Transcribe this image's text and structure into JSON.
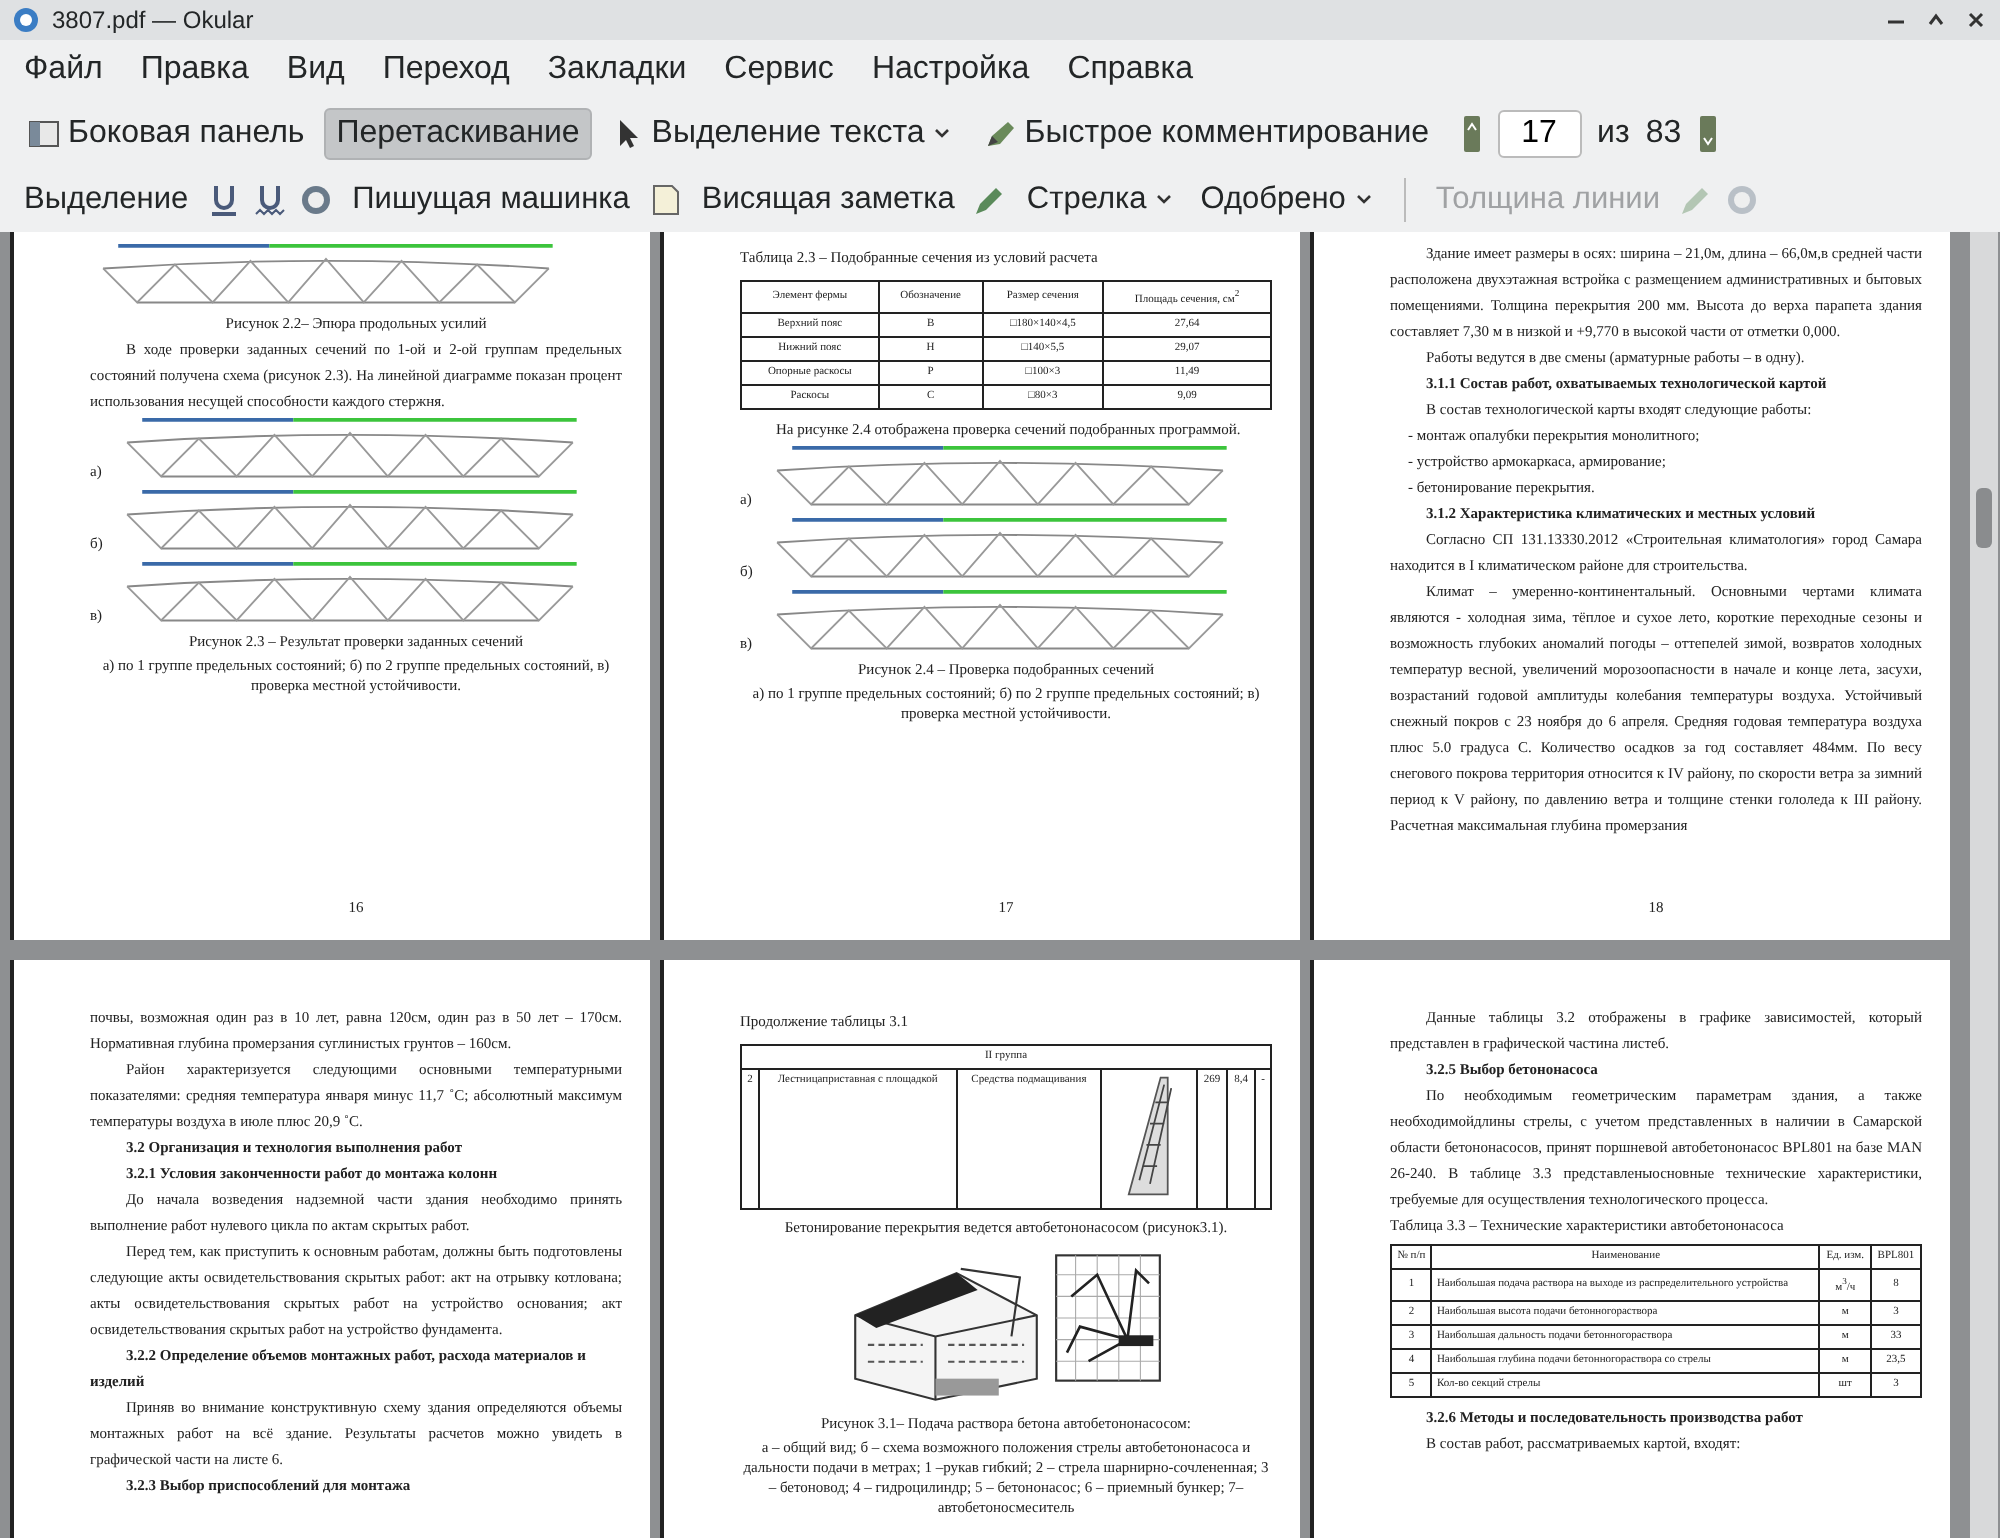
{
  "window": {
    "title": "3807.pdf — Okular"
  },
  "menu": [
    "Файл",
    "Правка",
    "Вид",
    "Переход",
    "Закладки",
    "Сервис",
    "Настройка",
    "Справка"
  ],
  "toolbar": [
    {
      "kind": "button",
      "label": "Боковая панель",
      "selected": false
    },
    {
      "kind": "button",
      "label": "Перетаскивание",
      "selected": true
    },
    {
      "kind": "dropdown",
      "label": "Выделение текста",
      "selected": false
    },
    {
      "kind": "button",
      "label": "Быстрое комментирование",
      "selected": false
    },
    {
      "kind": "pager",
      "value": "17",
      "of": "из",
      "total": "83"
    }
  ],
  "annotation_bar": [
    {
      "kind": "text",
      "label": "Выделение",
      "disabled": false
    },
    {
      "kind": "icon",
      "disabled": false
    },
    {
      "kind": "icon",
      "disabled": false
    },
    {
      "kind": "icon",
      "disabled": false
    },
    {
      "kind": "text",
      "label": "Пишущая машинка",
      "disabled": false
    },
    {
      "kind": "icon",
      "disabled": false
    },
    {
      "kind": "text",
      "label": "Висящая заметка",
      "disabled": false
    },
    {
      "kind": "icon",
      "disabled": false
    },
    {
      "kind": "dropdown",
      "label": "Стрелка",
      "disabled": false
    },
    {
      "kind": "dropdown",
      "label": "Одобрено",
      "disabled": false
    },
    {
      "kind": "separator"
    },
    {
      "kind": "text",
      "label": "Толщина линии",
      "disabled": true
    },
    {
      "kind": "icon",
      "disabled": true
    },
    {
      "kind": "icon",
      "disabled": true
    }
  ],
  "pages": [
    {
      "blocks": [
        {
          "kind": "truss"
        },
        {
          "kind": "caption",
          "text": "Рисунок 2.2– Эпюра продольных усилий"
        },
        {
          "kind": "para",
          "text": "В ходе проверки заданных сечений по 1-ой и 2-ой группам предельных состояний получена схема (рисунок 2.3). На линейной диаграмме показан процент использования несущей способности каждого стержня."
        },
        {
          "kind": "truss",
          "label": "а)"
        },
        {
          "kind": "truss",
          "label": "б)"
        },
        {
          "kind": "truss",
          "label": "в)"
        },
        {
          "kind": "caption",
          "text": "Рисунок 2.3 – Результат проверки заданных сечений"
        },
        {
          "kind": "caption",
          "text": "а) по 1 группе предельных состояний; б) по 2 группе предельных состояний, в) проверка местной устойчивости."
        },
        {
          "kind": "page_number",
          "text": "16"
        }
      ]
    },
    {
      "blocks": [
        {
          "kind": "label",
          "text": "Таблица 2.3 – Подобранные сечения из условий расчета"
        },
        {
          "kind": "table",
          "columns": [
            "Элемент фермы",
            "Обозначение",
            "Размер сечения",
            "Площадь сечения, см$^{2}$"
          ],
          "rows": [
            [
              "Верхний пояс",
              "В",
              "□180×140×4,5",
              "27,64"
            ],
            [
              "Нижний пояс",
              "Н",
              "□140×5,5",
              "29,07"
            ],
            [
              "Опорные раскосы",
              "Р",
              "□100×3",
              "11,49"
            ],
            [
              "Раскосы",
              "С",
              "□80×3",
              "9,09"
            ]
          ]
        },
        {
          "kind": "para",
          "text": "На рисунке 2.4 отображена проверка сечений подобранных программой."
        },
        {
          "kind": "truss",
          "label": "а)"
        },
        {
          "kind": "truss",
          "label": "б)"
        },
        {
          "kind": "truss",
          "label": "в)"
        },
        {
          "kind": "caption",
          "text": "Рисунок 2.4 – Проверка подобранных сечений"
        },
        {
          "kind": "caption",
          "text": "а) по 1 группе предельных состояний; б) по 2 группе предельных состояний; в) проверка местной устойчивости."
        },
        {
          "kind": "page_number",
          "text": "17"
        }
      ]
    },
    {
      "blocks": [
        {
          "kind": "para",
          "text": "Здание имеет размеры в осях: ширина – 21,0м, длина – 66,0м,в средней части расположена двухэтажная встройка с размещением административных и бытовых помещениями. Толщина перекрытия 200 мм. Высота до верха парапета здания составляет 7,30 м в низкой и +9,770 в высокой части от отметки 0,000."
        },
        {
          "kind": "para",
          "text": "Работы ведутся в две смены (арматурные работы – в одну)."
        },
        {
          "kind": "heading",
          "text": "3.1.1 Состав работ, охватываемых технологической картой"
        },
        {
          "kind": "para",
          "text": "В состав технологической карты входят следующие работы:"
        },
        {
          "kind": "list_item",
          "text": "- монтаж опалубки перекрытия монолитного;"
        },
        {
          "kind": "list_item",
          "text": "- устройство армокаркаса, армирование;"
        },
        {
          "kind": "list_item",
          "text": "- бетонирование перекрытия."
        },
        {
          "kind": "heading",
          "text": "3.1.2 Характеристика климатических и местных условий"
        },
        {
          "kind": "para",
          "text": "Согласно СП 131.13330.2012 «Строительная климатология» город Самара находится в I климатическом районе для строительства."
        },
        {
          "kind": "para",
          "text": "Климат – умеренно-континентальный. Основными чертами климата являются - холодная зима, тёплое и сухое лето, короткие переходные сезоны и возможность глубоких аномалий погоды – оттепелей зимой, возвратов холодных температур весной, увеличений морозоопасности в начале и конце лета, засухи, возрастаний годовой амплитуды колебания температуры воздуха. Устойчивый снежный покров с 23 ноября до 6 апреля. Средняя годовая температура воздуха плюс 5.0 градуса С. Количество осадков за год составляет 484мм. По весу снегового покрова территория относится к IV району, по скорости ветра за зимний период к V району, по давлению ветра и толщине стенки гололеда к III району. Расчетная максимальная глубина промерзания"
        },
        {
          "kind": "page_number",
          "text": "18"
        }
      ]
    },
    {
      "blocks": [
        {
          "kind": "plain",
          "text": "почвы, возможная один раз в 10 лет, равна 120см, один раз в 50 лет – 170см. Нормативная глубина промерзания суглинистых грунтов – 160см."
        },
        {
          "kind": "para",
          "text": "Район характеризуется следующими основными температурными показателями: средняя температура января минус 11,7 ˚С; абсолютный максимум температуры воздуха в июле плюс 20,9 ˚С."
        },
        {
          "kind": "heading",
          "text": "3.2 Организация и технология выполнения работ"
        },
        {
          "kind": "heading",
          "text": "3.2.1 Условия законченности работ до монтажа колонн"
        },
        {
          "kind": "para",
          "text": "До начала возведения надземной части здания необходимо принять выполнение работ нулевого цикла по актам скрытых работ."
        },
        {
          "kind": "para",
          "text": "Перед тем, как приступить к основным работам, должны быть подготовлены следующие акты освидетельствования скрытых работ: акт на отрывку котлована; акты освидетельствования скрытых работ на устройство основания; акт освидетельствования скрытых работ на устройство фундамента."
        },
        {
          "kind": "heading",
          "text": "3.2.2 Определение объемов монтажных работ, расхода материалов и изделий"
        },
        {
          "kind": "para",
          "text": "Приняв во внимание конструктивную схему здания определяются объемы монтажных работ на всё здание. Результаты расчетов можно увидеть в графической части на листе 6."
        },
        {
          "kind": "heading",
          "text": "3.2.3 Выбор приспособлений для монтажа"
        }
      ]
    },
    {
      "blocks": [
        {
          "kind": "label",
          "text": "Продолжение таблицы 3.1"
        },
        {
          "kind": "group_table",
          "group": "II группа",
          "rows": [
            [
              "2",
              "Лестницаприставная с площадкой",
              "Средства подмащивания",
              {
                "kind": "picture"
              },
              "269",
              "8,4",
              "-"
            ]
          ]
        },
        {
          "kind": "caption",
          "text": "Бетонирование перекрытия ведется автобетононасосом (рисунок3.1)."
        },
        {
          "kind": "pump_figure"
        },
        {
          "kind": "caption",
          "text": "Рисунок 3.1– Подача раствора бетона автобетононасосом:"
        },
        {
          "kind": "caption",
          "text": "а – общий вид; б – схема возможного положения стрелы автобетононасоса и дальности подачи в метрах; 1 –рукав гибкий; 2 – стрела шарнирно-сочлененная; 3 – бетоновод; 4 – гидроцилиндр; 5 – бетононасос; 6 – приемный бункер; 7– автобетоносмеситель"
        }
      ]
    },
    {
      "blocks": [
        {
          "kind": "para",
          "text": "Данные таблицы 3.2 отображены в графике зависимостей, который представлен в графической частина листеб."
        },
        {
          "kind": "heading",
          "text": "3.2.5 Выбор бетононасоса"
        },
        {
          "kind": "para",
          "text": "По необходимым геометрическим параметрам здания, а также необходимойдлины стрелы, с учетом представленных в наличии в Самарской области бетононасосов, принят поршневой автобетононасос BPL801 на базе MAN 26-240. В таблице 3.3 представленыосновные технические характеристики, требуемые для осуществления технологического процесса."
        },
        {
          "kind": "plain",
          "text": "Таблица 3.3 – Технические характеристики автобетононасоса"
        },
        {
          "kind": "table",
          "columns": [
            "№ п/п",
            "Наименование",
            "Ед. изм.",
            "BPL801"
          ],
          "rows": [
            [
              "1",
              "Наибольшая подача раствора на выходе из распределительного устройства",
              "м$^{3}$/ч",
              "8"
            ],
            [
              "2",
              "Наибольшая высота подачи бетонногораствора",
              "м",
              "3"
            ],
            [
              "3",
              "Наибольшая дальность подачи бетонногораствора",
              "м",
              "33"
            ],
            [
              "4",
              "Наибольшая глубина подачи бетонногораствора со стрелы",
              "м",
              "23,5"
            ],
            [
              "5",
              "Кол-во секций стрелы",
              "шт",
              "3"
            ]
          ]
        },
        {
          "kind": "heading",
          "text": "3.2.6 Методы и последовательность производства работ"
        },
        {
          "kind": "para",
          "text": "В состав работ, рассматриваемых картой, входят:"
        }
      ]
    }
  ]
}
